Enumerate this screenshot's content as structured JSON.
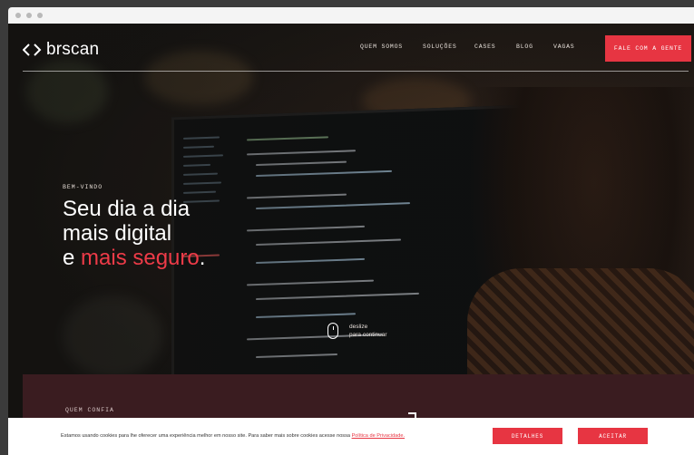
{
  "browser": {
    "dots": [
      "#b9b9b9",
      "#b9b9b9",
      "#b9b9b9"
    ]
  },
  "header": {
    "logo_text": "brscan",
    "nav": [
      "QUEM SOMOS",
      "SOLUÇÕES",
      "CASES",
      "BLOG",
      "VAGAS"
    ],
    "cta_label": "FALE COM A GENTE",
    "accent_color": "#e73542"
  },
  "hero": {
    "eyebrow": "BEM-VINDO",
    "line1": "Seu dia a dia",
    "line2": "mais digital",
    "line3_prefix": "e ",
    "line3_accent": "mais seguro",
    "line3_suffix": "."
  },
  "scroll_hint": {
    "line1": "deslize",
    "line2": "para continuar",
    "icon": "mouse-icon"
  },
  "trust_section": {
    "label": "QUEM CONFIA",
    "background": "#3a1c20"
  },
  "cookie_banner": {
    "text": "Estamos usando cookies para lhe oferecer uma experiência melhor em nosso site. Para saber mais sobre cookies acesse nossa ",
    "link_text": "Política de Privacidade.",
    "details_label": "DETALHES",
    "accept_label": "ACEITAR"
  }
}
